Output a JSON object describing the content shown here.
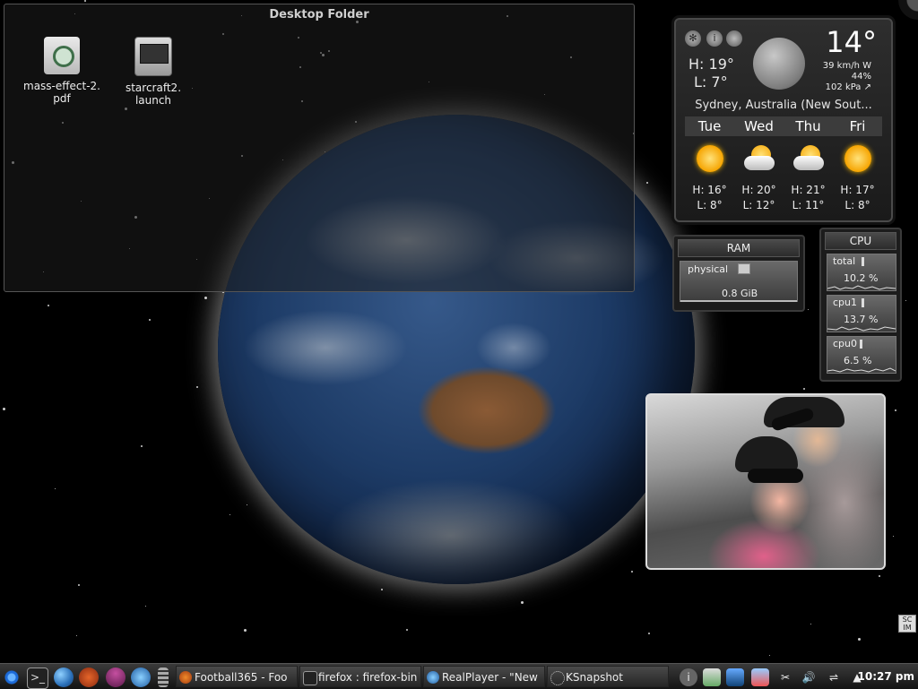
{
  "desktop": {
    "folder_title": "Desktop Folder",
    "files": [
      {
        "name": "mass-effect-2.\npdf",
        "line1": "mass-effect-2.",
        "line2": "pdf",
        "icon": "pdf-document-icon"
      },
      {
        "name": "starcraft2.\nlaunch",
        "line1": "starcraft2.",
        "line2": "launch",
        "icon": "launcher-icon"
      }
    ]
  },
  "weather": {
    "current_temp": "14°",
    "high": "H: 19°",
    "low": "L: 7°",
    "wind": "39 km/h W",
    "humidity": "44%",
    "pressure": "102 kPa ↗",
    "location": "Sydney, Australia (New Sout...",
    "forecast": [
      {
        "day": "Tue",
        "high": "H: 16°",
        "low": "L: 8°",
        "icon": "sunny-icon"
      },
      {
        "day": "Wed",
        "high": "H: 20°",
        "low": "L: 12°",
        "icon": "partly-cloudy-icon"
      },
      {
        "day": "Thu",
        "high": "H: 21°",
        "low": "L: 11°",
        "icon": "partly-cloudy-icon"
      },
      {
        "day": "Fri",
        "high": "H: 17°",
        "low": "L: 8°",
        "icon": "sunny-icon"
      }
    ]
  },
  "ram": {
    "title": "RAM",
    "label": "physical",
    "value": "0.8 GiB"
  },
  "cpu": {
    "title": "CPU",
    "items": [
      {
        "label": "total",
        "value": "10.2 %"
      },
      {
        "label": "cpu1",
        "value": "13.7 %"
      },
      {
        "label": "cpu0",
        "value": "6.5 %"
      }
    ]
  },
  "sc_widget": {
    "line1": "SC",
    "line2": "IM"
  },
  "taskbar": {
    "launchers": [
      "kmenu-icon",
      "terminal-icon",
      "globe-icon",
      "firefox-icon",
      "mushroom-icon",
      "realplayer-icon",
      "pager-icon"
    ],
    "tasks": [
      {
        "label": "Football365 - Foo",
        "icon": "firefox-icon"
      },
      {
        "label": "firefox : firefox-bin",
        "icon": "terminal-icon"
      },
      {
        "label": "RealPlayer - \"New",
        "icon": "realplayer-icon"
      },
      {
        "label": "KSnapshot",
        "icon": "ksnapshot-icon"
      }
    ],
    "term_glyph": ">_",
    "clock": "10:27 pm"
  }
}
